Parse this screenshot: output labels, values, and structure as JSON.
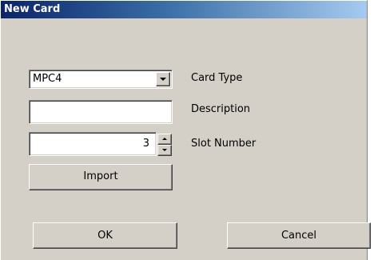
{
  "window": {
    "title": "New Card"
  },
  "card_type": {
    "selected": "MPC4",
    "label": "Card Type"
  },
  "description": {
    "value": "",
    "label": "Description"
  },
  "slot_number": {
    "value": "3",
    "label": "Slot Number"
  },
  "buttons": {
    "import_label": "Import",
    "ok_label": "OK",
    "cancel_label": "Cancel"
  },
  "icons": {
    "dropdown": "chevron-down-icon",
    "spin_up": "arrow-up-icon",
    "spin_down": "arrow-down-icon"
  },
  "colors": {
    "titlebar_start": "#0a246a",
    "titlebar_end": "#a6caf0",
    "dialog_face": "#d4d0c8"
  }
}
